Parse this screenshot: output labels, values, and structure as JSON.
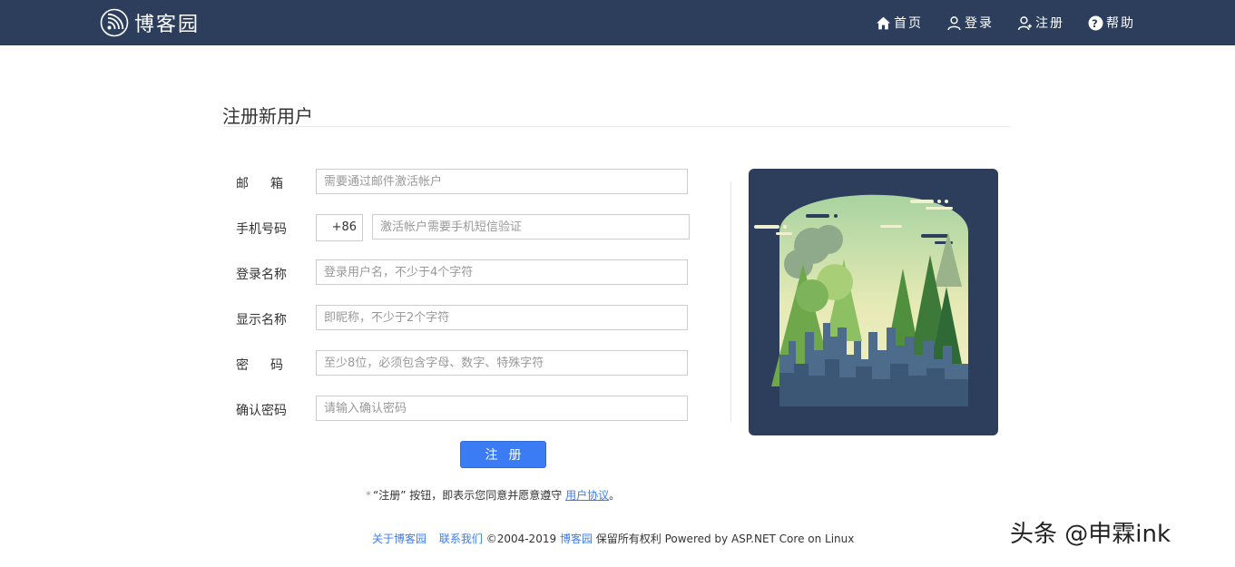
{
  "brand": {
    "name": "博客园",
    "logo_icon": "wifi-broadcast-icon"
  },
  "nav": [
    {
      "label": "首页",
      "icon": "home-icon"
    },
    {
      "label": "登录",
      "icon": "user-icon"
    },
    {
      "label": "注册",
      "icon": "user-add-icon"
    },
    {
      "label": "帮助",
      "icon": "help-icon"
    }
  ],
  "page": {
    "title": "注册新用户"
  },
  "form": {
    "email": {
      "label": "邮箱",
      "placeholder": "需要通过邮件激活帐户"
    },
    "phone": {
      "label": "手机号码",
      "country_code": "+86",
      "placeholder": "激活帐户需要手机短信验证"
    },
    "login_name": {
      "label": "登录名称",
      "placeholder": "登录用户名，不少于4个字符"
    },
    "display_name": {
      "label": "显示名称",
      "placeholder": "即昵称，不少于2个字符"
    },
    "password": {
      "label": "密码",
      "placeholder": "至少8位，必须包含字母、数字、特殊字符"
    },
    "confirm_password": {
      "label": "确认密码",
      "placeholder": "请输入确认密码"
    },
    "submit_label": "注册"
  },
  "agreement": {
    "required_mark": "*",
    "text": "“注册” 按钮，即表示您同意并愿意遵守",
    "link": "用户协议",
    "end": "。"
  },
  "footer": {
    "about": "关于博客园",
    "contact": "联系我们",
    "copyright": "©2004-2019",
    "site": "博客园",
    "rights": "保留所有权利 Powered by ASP.NET Core on Linux"
  },
  "watermark": "头条 @申霖ink",
  "colors": {
    "topbar": "#2c3e5c",
    "accent": "#3b7cf4",
    "illustration_bg": "#2c3e5c"
  }
}
